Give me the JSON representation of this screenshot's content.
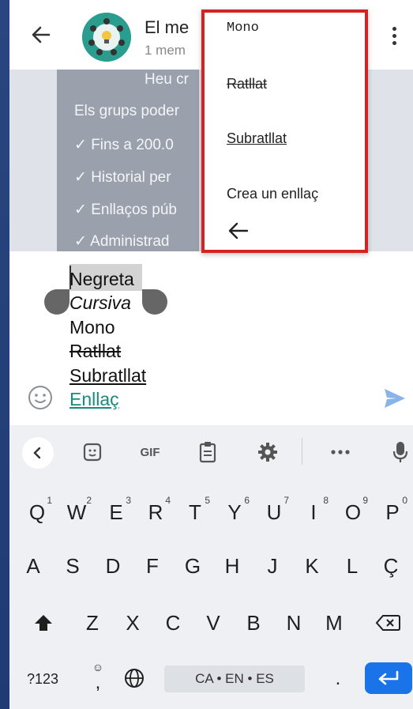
{
  "header": {
    "title": "El me",
    "subtitle": "1 mem"
  },
  "intro": {
    "heading": "Heu cr",
    "line1": "Els grups poder",
    "items": [
      "Fins a 200.0",
      "Historial per",
      "Enllaços púb",
      "Administrad"
    ]
  },
  "composer": {
    "bold": "Negreta",
    "italic": "Cursiva",
    "mono": "Mono",
    "strike": "Ratllat",
    "underline": "Subratllat",
    "link": "Enllaç"
  },
  "format_menu": {
    "mono": "Mono",
    "strike": "Ratllat",
    "underline": "Subratllat",
    "link": "Crea un enllaç"
  },
  "keyboard": {
    "toolbar": {
      "gif": "GIF"
    },
    "row1": [
      {
        "k": "Q",
        "n": "1"
      },
      {
        "k": "W",
        "n": "2"
      },
      {
        "k": "E",
        "n": "3"
      },
      {
        "k": "R",
        "n": "4"
      },
      {
        "k": "T",
        "n": "5"
      },
      {
        "k": "Y",
        "n": "6"
      },
      {
        "k": "U",
        "n": "7"
      },
      {
        "k": "I",
        "n": "8"
      },
      {
        "k": "O",
        "n": "9"
      },
      {
        "k": "P",
        "n": "0"
      }
    ],
    "row2": [
      "A",
      "S",
      "D",
      "F",
      "G",
      "H",
      "J",
      "K",
      "L",
      "Ç"
    ],
    "row3": [
      "Z",
      "X",
      "C",
      "V",
      "B",
      "N",
      "M"
    ],
    "num_label": "?123",
    "comma": ",",
    "lang": "CA • EN • ES",
    "period": "."
  },
  "colors": {
    "popup_border": "#d32323",
    "link": "#1a8a7a",
    "send": "#8ab4e8",
    "enter": "#1a73e8"
  }
}
